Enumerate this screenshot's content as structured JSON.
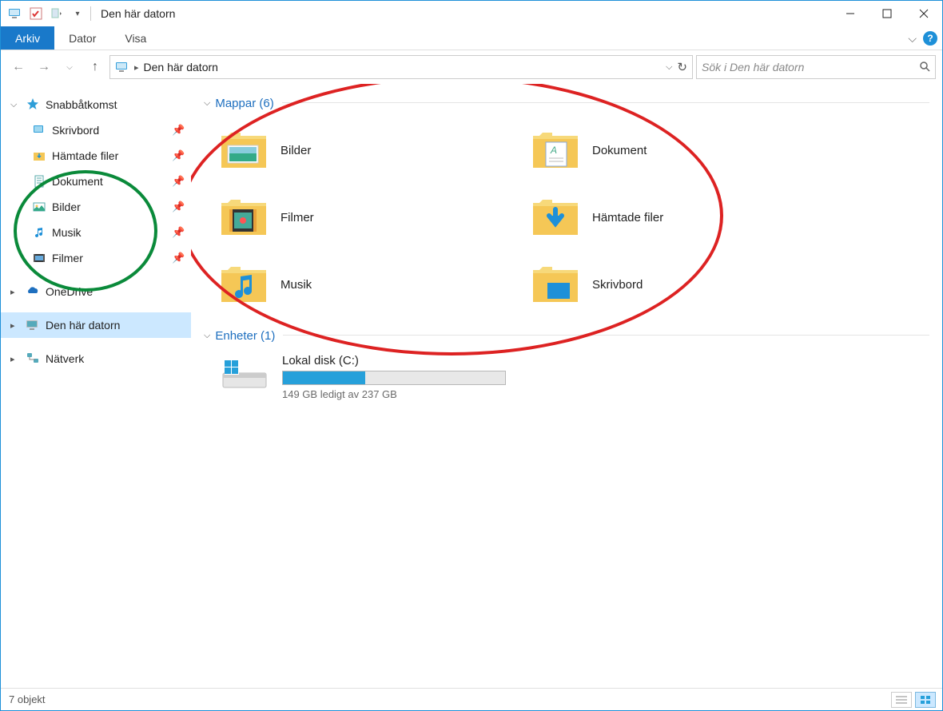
{
  "titlebar": {
    "title": "Den här datorn"
  },
  "ribbon": {
    "tabs": [
      "Arkiv",
      "Dator",
      "Visa"
    ],
    "active_index": 0
  },
  "navbar": {
    "breadcrumb": "Den här datorn",
    "search_placeholder": "Sök i Den här datorn"
  },
  "sidebar": {
    "quick_access": {
      "label": "Snabbåtkomst",
      "items": [
        {
          "label": "Skrivbord",
          "pinned": true,
          "icon": "desktop"
        },
        {
          "label": "Hämtade filer",
          "pinned": true,
          "icon": "downloads"
        },
        {
          "label": "Dokument",
          "pinned": true,
          "icon": "documents"
        },
        {
          "label": "Bilder",
          "pinned": true,
          "icon": "pictures"
        },
        {
          "label": "Musik",
          "pinned": true,
          "icon": "music"
        },
        {
          "label": "Filmer",
          "pinned": true,
          "icon": "videos"
        }
      ]
    },
    "onedrive": {
      "label": "OneDrive"
    },
    "this_pc": {
      "label": "Den här datorn"
    },
    "network": {
      "label": "Nätverk"
    }
  },
  "content": {
    "folders_header": "Mappar (6)",
    "folders": [
      {
        "label": "Bilder",
        "icon": "pictures"
      },
      {
        "label": "Dokument",
        "icon": "documents"
      },
      {
        "label": "Filmer",
        "icon": "videos"
      },
      {
        "label": "Hämtade filer",
        "icon": "downloads"
      },
      {
        "label": "Musik",
        "icon": "music"
      },
      {
        "label": "Skrivbord",
        "icon": "desktop"
      }
    ],
    "devices_header": "Enheter (1)",
    "drive": {
      "name": "Lokal disk (C:)",
      "free_text": "149 GB ledigt av 237 GB",
      "fill_percent": 37
    }
  },
  "statusbar": {
    "text": "7 objekt"
  }
}
